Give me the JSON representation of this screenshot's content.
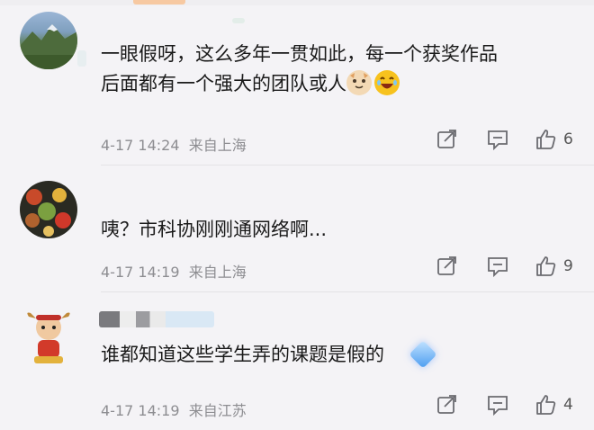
{
  "comments": [
    {
      "text_line1": "一眼假呀，这么多年一贯如此，每一个获奖作品",
      "text_line2": "后面都有一个强大的团队或人",
      "time": "4-17 14:24",
      "location": "来自上海",
      "likes": "6",
      "emojis": [
        "cat-face-emoji",
        "laughing-emoji"
      ]
    },
    {
      "text_line1": "咦？市科协刚刚通网络啊...",
      "time": "4-17 14:19",
      "location": "来自上海",
      "likes": "9"
    },
    {
      "text_line1": "谁都知道这些学生弄的课题是假的",
      "time": "4-17 14:19",
      "location": "来自江苏",
      "likes": "4",
      "emojis": [
        "diamond-emoji"
      ]
    }
  ],
  "icons": {
    "repost": "repost-icon",
    "comment": "comment-icon",
    "like": "like-icon"
  },
  "colors": {
    "background": "#f4f3f6",
    "text": "#1a1a1a",
    "meta": "#8d8d91",
    "icon": "#6b6b70"
  }
}
